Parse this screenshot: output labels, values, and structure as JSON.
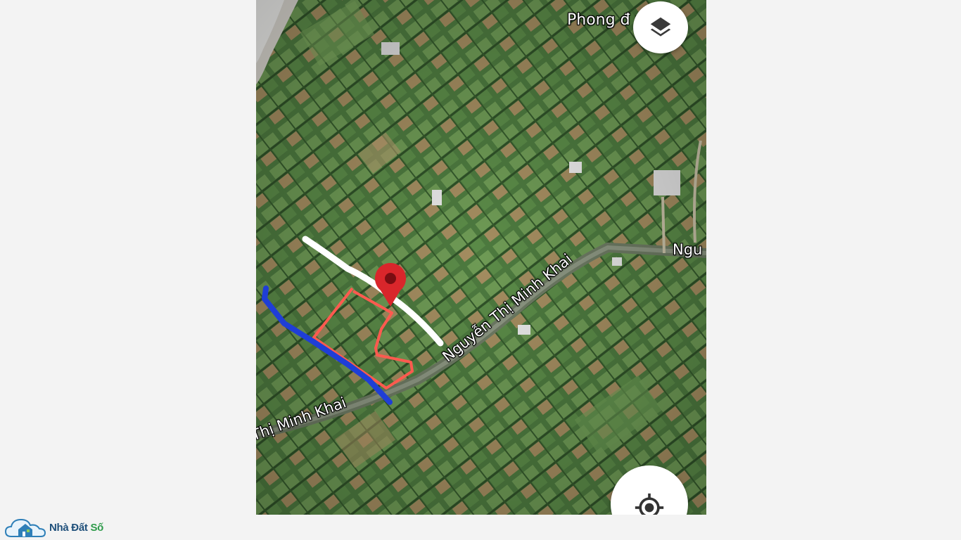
{
  "map": {
    "view": "satellite",
    "road_labels": {
      "main": "Nguyễn Thị Minh Khai",
      "lower": "Thị Minh Khai",
      "right": "Ngu",
      "top": "Phong đ      ú C"
    },
    "marker": {
      "color": "#d9262b",
      "icon": "map-pin-icon"
    },
    "overlays": [
      {
        "name": "parcel-outline",
        "color": "#ff5a4f"
      },
      {
        "name": "white-route",
        "color": "#ffffff"
      },
      {
        "name": "blue-route",
        "color": "#1f3ed6"
      }
    ],
    "controls": {
      "layers": {
        "icon": "layers-icon"
      },
      "locate": {
        "icon": "my-location-icon"
      }
    }
  },
  "watermark": {
    "icon": "house-cloud-logo",
    "word1": "Nhà Đất",
    "word2": "Số"
  }
}
